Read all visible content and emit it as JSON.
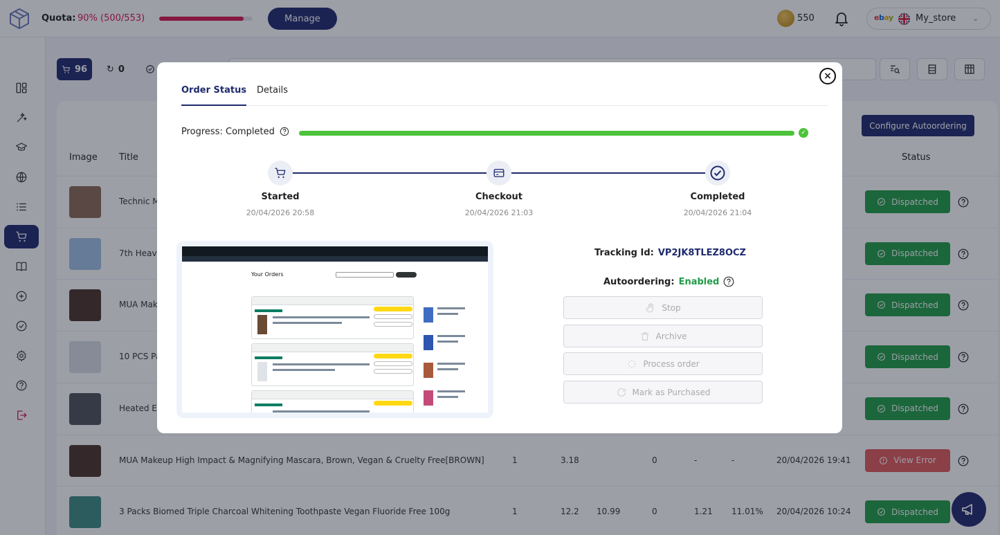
{
  "topbar": {
    "quota_label": "Quota:",
    "quota_value": "90% (500/553)",
    "quota_fraction": 0.904,
    "manage_label": "Manage",
    "coins": "550",
    "store_brand": [
      "e",
      "b",
      "a",
      "y"
    ],
    "store_name": "My_store"
  },
  "sidebar": {
    "items": [
      "dashboard-icon",
      "magic-wand-icon",
      "graduation-cap-icon",
      "globe-icon",
      "list-icon",
      "cart-icon",
      "book-icon",
      "plus-circle-icon",
      "check-circle-icon",
      "gear-icon",
      "help-icon",
      "logout-icon"
    ],
    "active_index": 5
  },
  "page": {
    "cart_count": "96",
    "retry_count": "0",
    "configure_label": "Configure Autoordering",
    "headers": {
      "image": "Image",
      "title": "Title",
      "status": "Status"
    },
    "rows": [
      {
        "title": "Technic M",
        "status": "Dispatched",
        "kind": "ok",
        "cells": []
      },
      {
        "title": "7th Heave",
        "status": "Dispatched",
        "kind": "ok",
        "cells": []
      },
      {
        "title": "MUA Make",
        "status": "Dispatched",
        "kind": "ok",
        "cells": []
      },
      {
        "title": "10 PCS Pa",
        "status": "Dispatched",
        "kind": "ok",
        "cells": []
      },
      {
        "title": "Heated Ey",
        "status": "Dispatched",
        "kind": "ok",
        "cells": []
      },
      {
        "title": "MUA Makeup High Impact & Magnifying Mascara, Brown, Vegan & Cruelty Free[BROWN]",
        "status": "View Error",
        "kind": "err",
        "cells": [
          "1",
          "3.18",
          "",
          "0",
          "-",
          "-",
          "20/04/2026 19:41"
        ]
      },
      {
        "title": "3 Packs Biomed Triple Charcoal Whitening Toothpaste Vegan Fluoride Free 100g",
        "status": "Dispatched",
        "kind": "ok",
        "cells": [
          "1",
          "12.2",
          "10.99",
          "0",
          "1.21",
          "11.01%",
          "20/04/2026 10:24"
        ]
      }
    ]
  },
  "modal": {
    "tabs": [
      {
        "label": "Order Status"
      },
      {
        "label": "Details"
      }
    ],
    "progress_label": "Progress: Completed",
    "progress_fraction": 1.0,
    "steps": [
      {
        "label": "Started",
        "date": "20/04/2026 20:58",
        "icon": "cart-icon"
      },
      {
        "label": "Checkout",
        "date": "20/04/2026 21:03",
        "icon": "card-icon"
      },
      {
        "label": "Completed",
        "date": "20/04/2026 21:04",
        "icon": "check-circle-icon"
      }
    ],
    "screenshot": {
      "heading": "Your Orders"
    },
    "tracking_label": "Tracking Id:",
    "tracking_id": "VP2JK8TLEZ8OCZ",
    "autoordering_label": "Autoordering:",
    "autoordering_value": "Enabled",
    "actions": [
      {
        "label": "Stop",
        "icon": "hand-icon"
      },
      {
        "label": "Archive",
        "icon": "trash-icon"
      },
      {
        "label": "Process order",
        "icon": "loader-icon"
      },
      {
        "label": "Mark as Purchased",
        "icon": "refresh-icon"
      }
    ]
  }
}
